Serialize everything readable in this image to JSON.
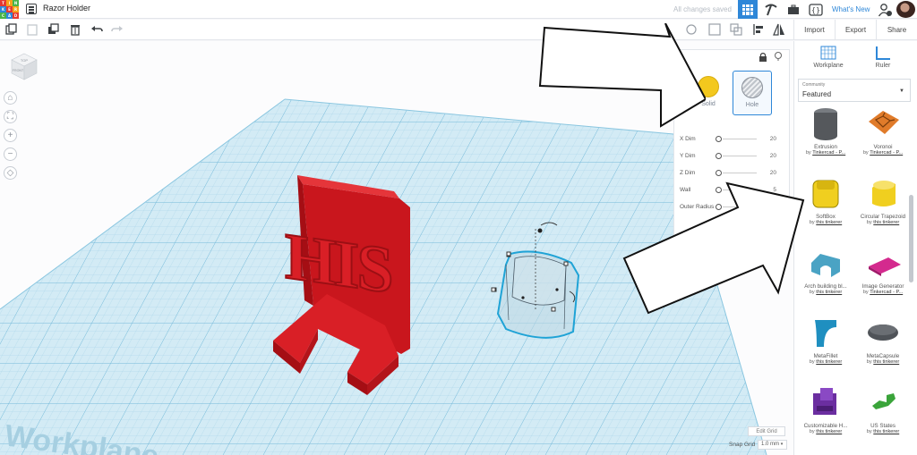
{
  "header": {
    "logo_letters": [
      "T",
      "I",
      "N",
      "K",
      "E",
      "R",
      "C",
      "A",
      "D"
    ],
    "logo_colors": [
      "#e6392f",
      "#f7a21b",
      "#49b448",
      "#2e87d8",
      "#e6392f",
      "#f7a21b",
      "#49b448",
      "#2e87d8",
      "#e6392f"
    ],
    "title": "Razor Holder",
    "save_status": "All changes saved",
    "whats_new": "What's New"
  },
  "toolbar": {
    "tools": [
      "copy-icon",
      "paste-icon",
      "duplicate-icon",
      "trash-icon",
      "undo-icon",
      "redo-icon"
    ],
    "right_tools": [
      "note-icon",
      "group-icon",
      "ungroup-icon",
      "align-icon",
      "mirror-icon"
    ],
    "import": "Import",
    "export": "Export",
    "share": "Share"
  },
  "viewcube": {
    "top": "TOP",
    "front": "FRONT"
  },
  "scene": {
    "workplane_text": "Workplane",
    "model_text": "HIS"
  },
  "inspector": {
    "solid_label": "Solid",
    "hole_label": "Hole",
    "selected": "Hole",
    "dims": [
      {
        "label": "X Dim",
        "value": "20"
      },
      {
        "label": "Y Dim",
        "value": "20"
      },
      {
        "label": "Z Dim",
        "value": "20"
      },
      {
        "label": "Wall",
        "value": "5"
      },
      {
        "label": "Outer Radius",
        "value": ""
      }
    ]
  },
  "grid": {
    "edit_grid": "Edit Grid",
    "snap_label": "Snap Grid",
    "snap_value": "1.0 mm"
  },
  "library": {
    "workplane": "Workplane",
    "ruler": "Ruler",
    "category_label": "Community",
    "category_value": "Featured",
    "items": [
      {
        "name": "Extrusion",
        "by": "by",
        "author": "Tinkercad - P...",
        "shape": "cylinder",
        "color": "#55585c"
      },
      {
        "name": "Voronoi",
        "by": "by",
        "author": "Tinkercad - P...",
        "shape": "voronoi",
        "color": "#e07b2a"
      },
      {
        "name": "SoftBox",
        "by": "by",
        "author": "this tinkerer",
        "shape": "softbox",
        "color": "#f0cf1f"
      },
      {
        "name": "Circular Trapezoid",
        "by": "by",
        "author": "this tinkerer",
        "shape": "trapezoid",
        "color": "#f0cf1f"
      },
      {
        "name": "Arch building bl...",
        "by": "by",
        "author": "this tinkerer",
        "shape": "arch",
        "color": "#4aa3c4"
      },
      {
        "name": "Image Generator",
        "by": "by",
        "author": "Tinkercad - P...",
        "shape": "plate",
        "color": "#d42a8e"
      },
      {
        "name": "MetaFillet",
        "by": "by",
        "author": "this tinkerer",
        "shape": "fillet",
        "color": "#1f8fc0"
      },
      {
        "name": "MetaCapsule",
        "by": "by",
        "author": "this tinkerer",
        "shape": "capsule",
        "color": "#4f5358"
      },
      {
        "name": "Customizable H...",
        "by": "by",
        "author": "this tinkerer",
        "shape": "hook",
        "color": "#6b2ea0"
      },
      {
        "name": "US States",
        "by": "by",
        "author": "this tinkerer",
        "shape": "states",
        "color": "#3aa43a"
      }
    ]
  },
  "colors": {
    "accent": "#2e87d8",
    "model_red": "#d91f26",
    "workplane": "#cfe8f3"
  }
}
